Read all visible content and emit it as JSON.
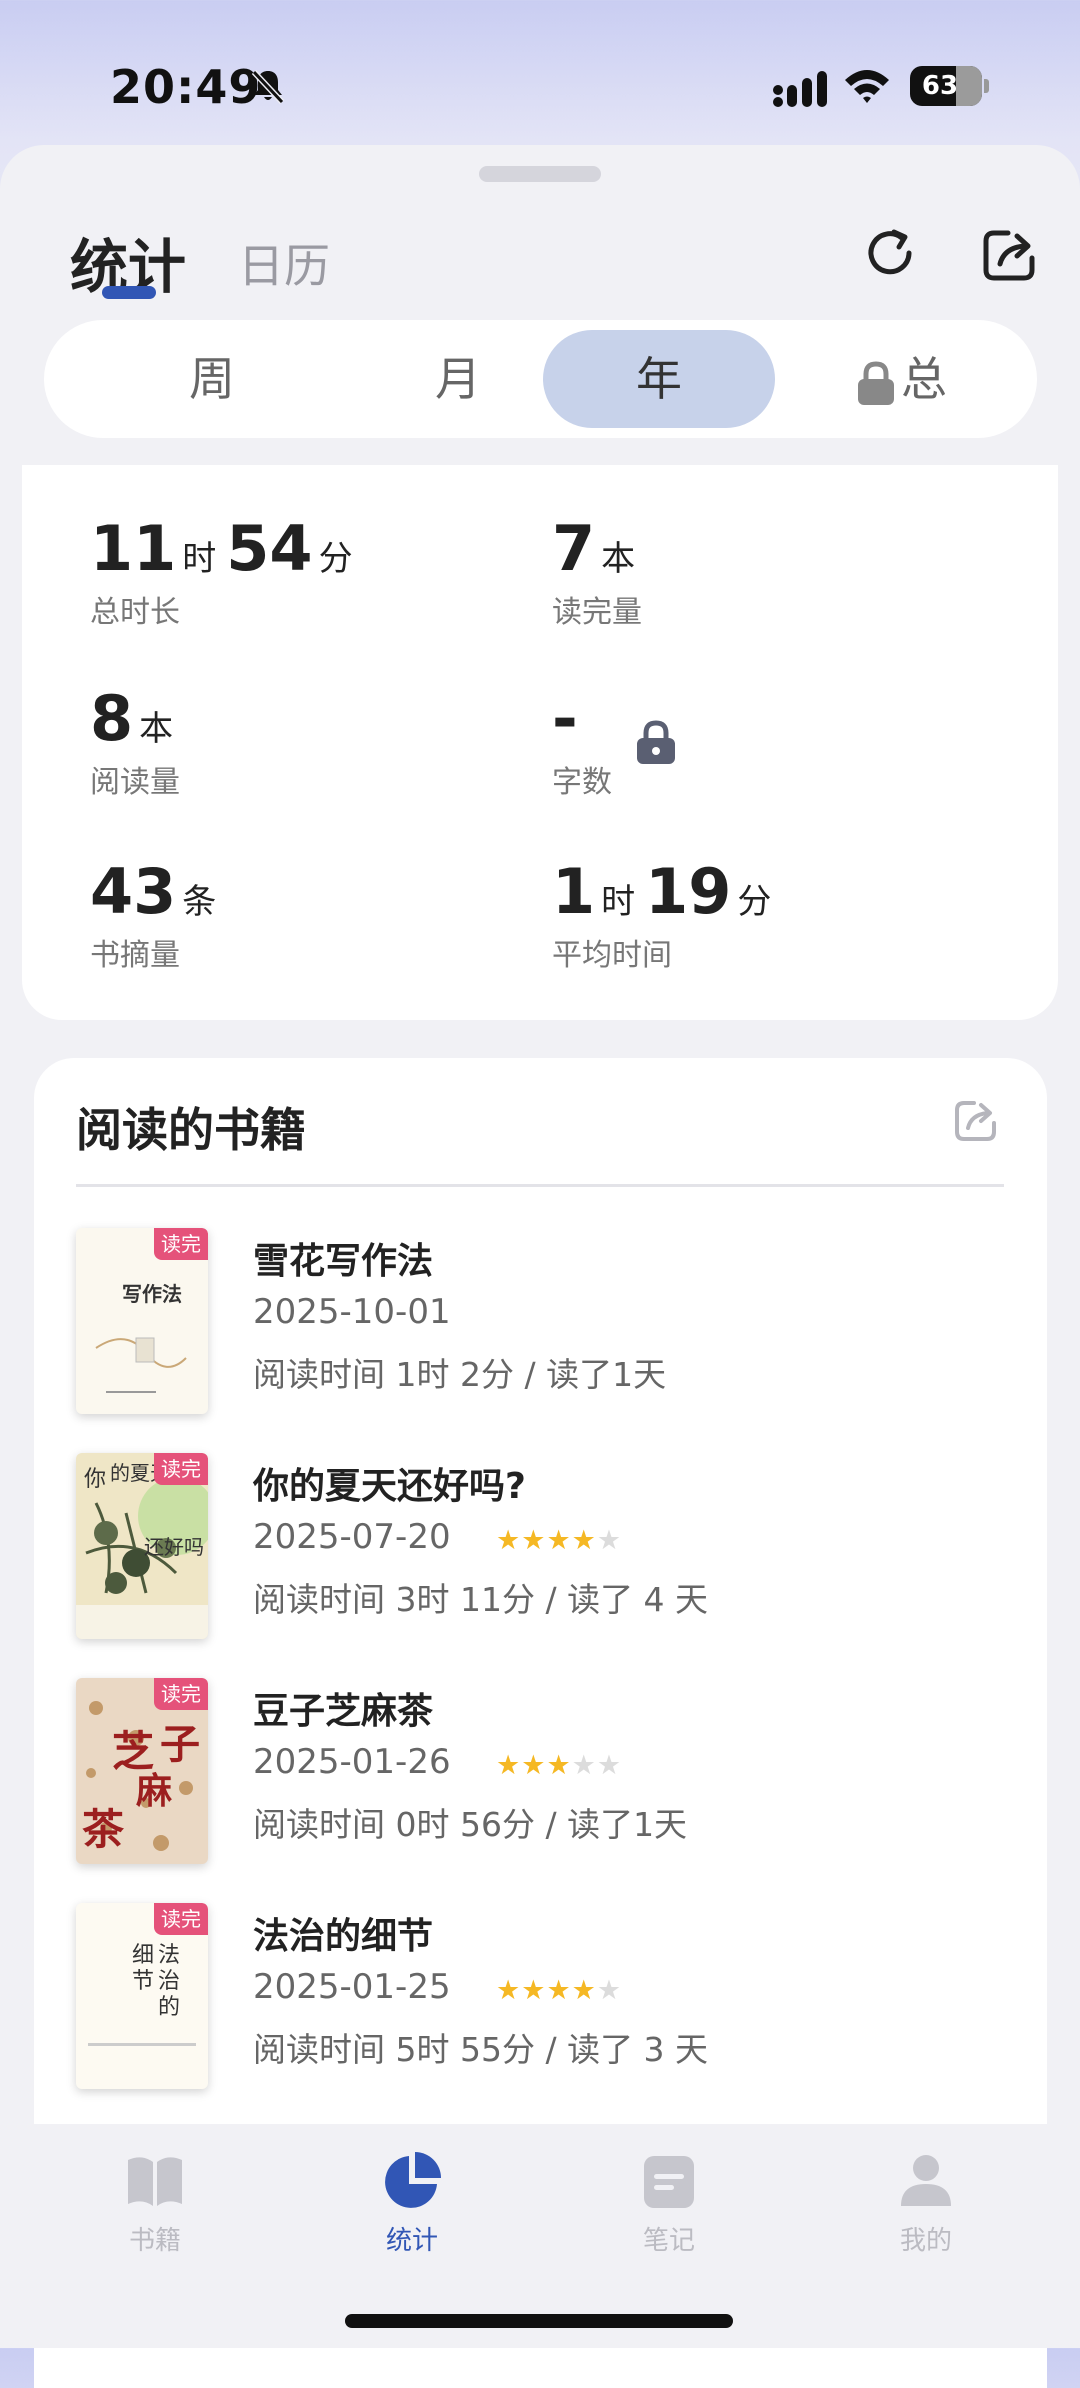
{
  "status_bar": {
    "time": "20:49",
    "battery": "63"
  },
  "header": {
    "tabs": [
      "统计",
      "日历"
    ],
    "active_tab": "统计"
  },
  "segments": {
    "items": [
      "周",
      "月",
      "年",
      "总"
    ],
    "active": "年"
  },
  "stats": {
    "total_time": {
      "hours": "11",
      "hours_unit": "时",
      "minutes": "54",
      "minutes_unit": "分",
      "label": "总时长"
    },
    "finished": {
      "value": "7",
      "unit": "本",
      "label": "读完量"
    },
    "reading": {
      "value": "8",
      "unit": "本",
      "label": "阅读量"
    },
    "words": {
      "value": "-",
      "label": "字数"
    },
    "excerpts": {
      "value": "43",
      "unit": "条",
      "label": "书摘量"
    },
    "avg_time": {
      "hours": "1",
      "hours_unit": "时",
      "minutes": "19",
      "minutes_unit": "分",
      "label": "平均时间"
    }
  },
  "books_section": {
    "title": "阅读的书籍",
    "books": [
      {
        "title": "雪花写作法",
        "date": "2025-10-01",
        "info": "阅读时间 1时 2分 / 读了1天",
        "badge": "读完",
        "rating": 0
      },
      {
        "title": "你的夏天还好吗?",
        "date": "2025-07-20",
        "info": "阅读时间 3时 11分 / 读了 4 天",
        "badge": "读完",
        "rating": 4
      },
      {
        "title": "豆子芝麻茶",
        "date": "2025-01-26",
        "info": "阅读时间 0时 56分 / 读了1天",
        "badge": "读完",
        "rating": 3
      },
      {
        "title": "法治的细节",
        "date": "2025-01-25",
        "info": "阅读时间 5时 55分 / 读了 3 天",
        "badge": "读完",
        "rating": 4
      }
    ]
  },
  "cover_text": {
    "book1": "写作法",
    "book2": [
      "你",
      "的夏天",
      "还好吗"
    ],
    "book3": [
      "芝",
      "麻",
      "茶",
      "子"
    ],
    "book4": [
      "法治的",
      "细节"
    ]
  },
  "tabbar": {
    "items": [
      {
        "label": "书籍",
        "icon": "book-icon"
      },
      {
        "label": "统计",
        "icon": "pie-chart-icon"
      },
      {
        "label": "笔记",
        "icon": "note-icon"
      },
      {
        "label": "我的",
        "icon": "person-icon"
      }
    ],
    "active": "统计"
  },
  "colors": {
    "accent": "#3156b5",
    "active_segment": "#c7d2ea",
    "badge": "#e5527a",
    "star": "#f5b824"
  }
}
